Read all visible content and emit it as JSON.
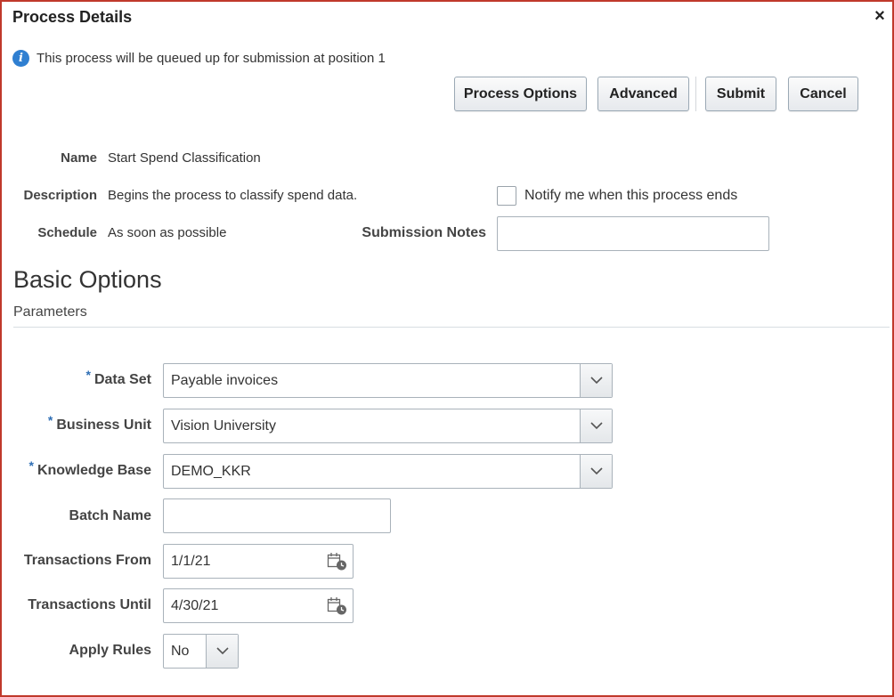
{
  "dialog": {
    "title": "Process Details",
    "close_label": "×",
    "info_message": "This process will be queued up for submission at position 1"
  },
  "buttons": {
    "process_options": "Process Options",
    "advanced": "Advanced",
    "submit": "Submit",
    "cancel": "Cancel"
  },
  "details": {
    "name_label": "Name",
    "name_value": "Start Spend Classification",
    "description_label": "Description",
    "description_value": "Begins the process to classify spend data.",
    "schedule_label": "Schedule",
    "schedule_value": "As soon as possible",
    "notify_label": "Notify me when this process ends",
    "notify_checked": false,
    "submission_notes_label": "Submission Notes",
    "submission_notes_value": ""
  },
  "basic_options": {
    "title": "Basic Options",
    "subtitle": "Parameters",
    "required_marker": "*",
    "data_set": {
      "label": "Data Set",
      "value": "Payable invoices",
      "required": true
    },
    "business_unit": {
      "label": "Business Unit",
      "value": "Vision University",
      "required": true
    },
    "knowledge_base": {
      "label": "Knowledge Base",
      "value": "DEMO_KKR",
      "required": true
    },
    "batch_name": {
      "label": "Batch Name",
      "value": ""
    },
    "transactions_from": {
      "label": "Transactions From",
      "value": "1/1/21"
    },
    "transactions_until": {
      "label": "Transactions Until",
      "value": "4/30/21"
    },
    "apply_rules": {
      "label": "Apply Rules",
      "value": "No"
    }
  },
  "colors": {
    "border_accent": "#c0392b",
    "info_icon": "#2f7fd1",
    "required_star": "#2f6fb5"
  }
}
